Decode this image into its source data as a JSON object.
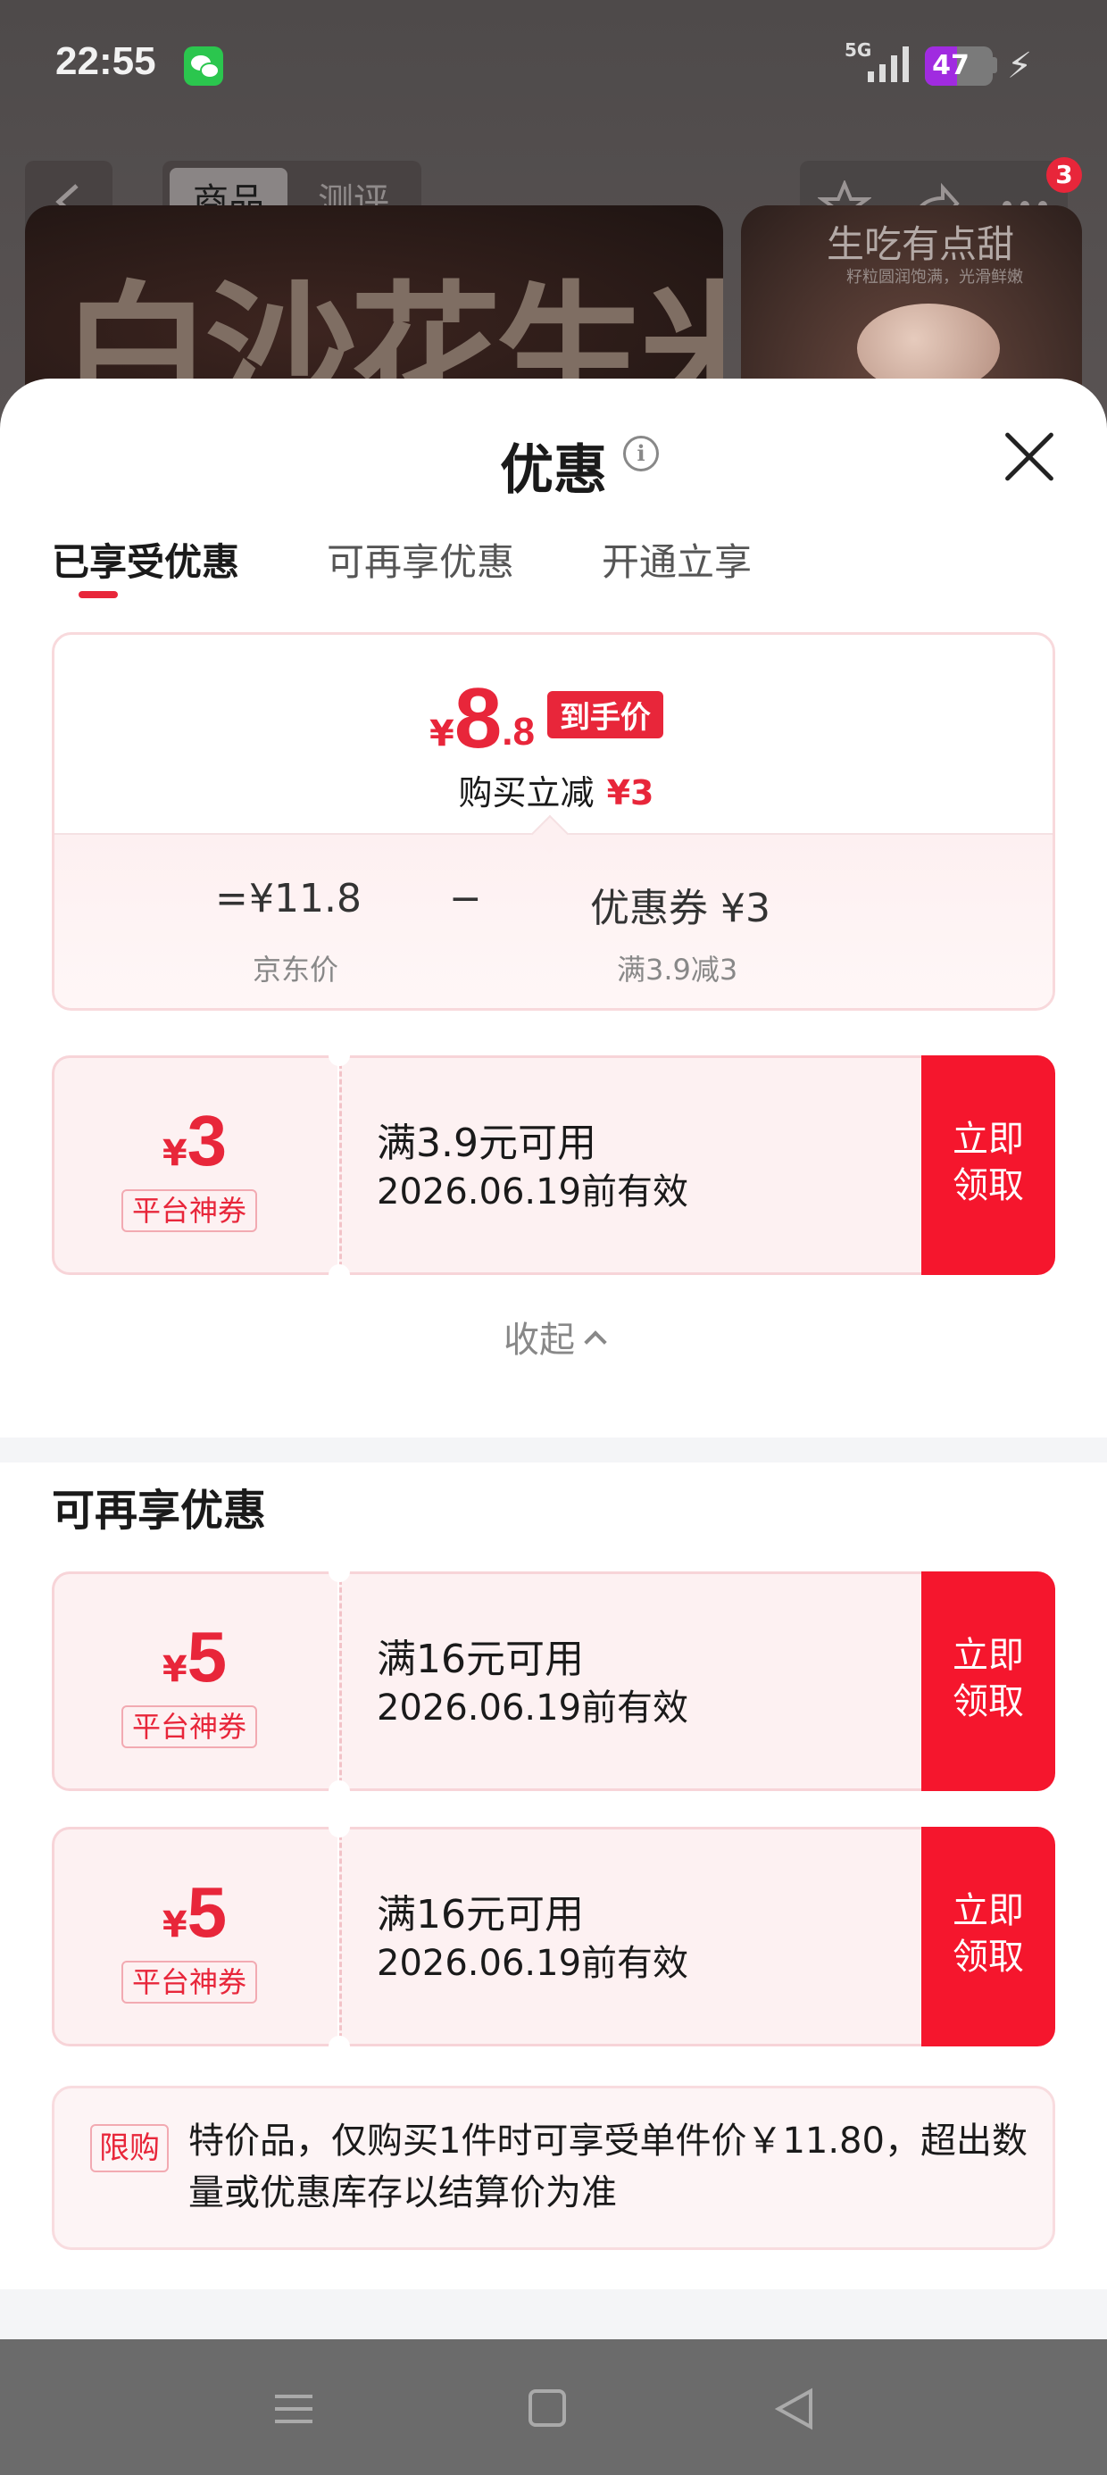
{
  "status_bar": {
    "time": "22:55",
    "network": "5G",
    "battery": "47",
    "battery_level": 0.47
  },
  "product_nav": {
    "tabs": [
      "商品",
      "测评"
    ],
    "cart_badge": "3"
  },
  "banner": {
    "left_text": "白沙花生米",
    "right_title": "生吃有点甜",
    "right_subtitle": "籽粒圆润饱满，光滑鲜嫩"
  },
  "sheet": {
    "title": "优惠",
    "info_icon": "i",
    "tabs": [
      "已享受优惠",
      "可再享优惠",
      "开通立享"
    ]
  },
  "summary": {
    "currency": "¥",
    "price_int": "8",
    "price_dec": ".8",
    "price_tag": "到手价",
    "reduce_label": "购买立减",
    "reduce_value": "¥3",
    "eq": "=",
    "jd_price": "¥11.8",
    "minus": "−",
    "coupon_label": "优惠券 ¥3",
    "jd_price_label": "京东价",
    "coupon_rule": "满3.9减3"
  },
  "enjoyed_coupon": {
    "currency": "¥",
    "amount": "3",
    "type": "平台神券",
    "condition": "满3.9元可用",
    "validity": "2026.06.19前有效",
    "button": "立即\n领取"
  },
  "collapse_label": "收起",
  "more_section": {
    "title": "可再享优惠",
    "coupons": [
      {
        "currency": "¥",
        "amount": "5",
        "type": "平台神券",
        "condition": "满16元可用",
        "validity": "2026.06.19前有效",
        "button": "立即\n领取"
      },
      {
        "currency": "¥",
        "amount": "5",
        "type": "平台神券",
        "condition": "满16元可用",
        "validity": "2026.06.19前有效",
        "button": "立即\n领取"
      }
    ]
  },
  "limit": {
    "badge": "限购",
    "text": "特价品，仅购买1件时可享受单件价￥11.80，超出数量或优惠库存以结算价为准"
  },
  "colors": {
    "accent": "#e8263a",
    "button": "#f5162d",
    "coupon_bg": "#fdf1f2"
  }
}
